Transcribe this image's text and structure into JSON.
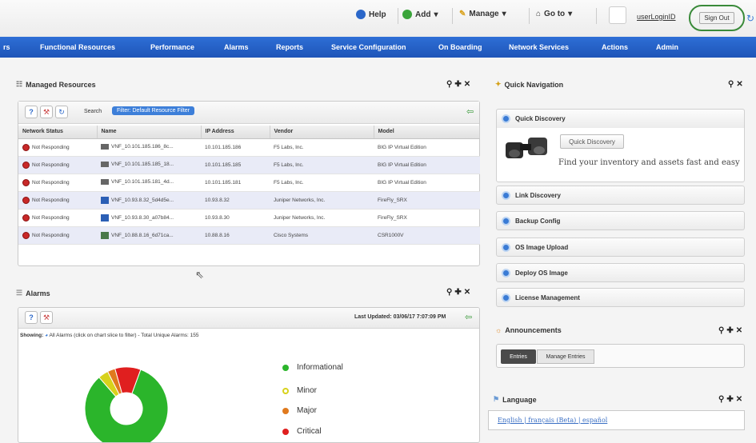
{
  "topbar": {
    "help": "Help",
    "add": "Add",
    "manage": "Manage",
    "goto": "Go to",
    "user": "userLoginID",
    "signout": "Sign Out"
  },
  "mainnav": [
    "rs",
    "Functional Resources",
    "Performance",
    "Alarms",
    "Reports",
    "Service Configuration",
    "On Boarding",
    "Network Services",
    "Actions",
    "Admin"
  ],
  "managed": {
    "title": "Managed Resources",
    "search_label": "Search",
    "filter": "Filter: Default Resource Filter",
    "columns": [
      "Network Status",
      "Name",
      "IP Address",
      "Vendor",
      "Model"
    ],
    "rows": [
      {
        "status": "Not Responding",
        "name": "VNF_10.101.185.186_8c...",
        "ip": "10.101.185.186",
        "vendor": "F5 Labs, Inc.",
        "model": "BIG IP Virtual Edition"
      },
      {
        "status": "Not Responding",
        "name": "VNF_10.101.185.185_18...",
        "ip": "10.101.185.185",
        "vendor": "F5 Labs, Inc.",
        "model": "BIG IP Virtual Edition"
      },
      {
        "status": "Not Responding",
        "name": "VNF_10.101.185.181_4d...",
        "ip": "10.101.185.181",
        "vendor": "F5 Labs, Inc.",
        "model": "BIG IP Virtual Edition"
      },
      {
        "status": "Not Responding",
        "name": "VNF_10.93.8.32_5d4d5e...",
        "ip": "10.93.8.32",
        "vendor": "Juniper Networks, Inc.",
        "model": "FireFly_SRX"
      },
      {
        "status": "Not Responding",
        "name": "VNF_10.93.8.30_a07b84...",
        "ip": "10.93.8.30",
        "vendor": "Juniper Networks, Inc.",
        "model": "FireFly_SRX"
      },
      {
        "status": "Not Responding",
        "name": "VNF_10.88.8.16_6d71ca...",
        "ip": "10.88.8.16",
        "vendor": "Cisco Systems",
        "model": "CSR1000V"
      }
    ]
  },
  "alarms": {
    "title": "Alarms",
    "last_updated": "Last Updated: 03/06/17 7:07:09 PM",
    "showing": "Showing:",
    "showing_text": "All Alarms (click on chart slice to filter) - Total Unique Alarms: 155",
    "legend": [
      {
        "label": "Informational",
        "color": "#2bb52b"
      },
      {
        "label": "Minor",
        "color": "#d8d21c"
      },
      {
        "label": "Major",
        "color": "#e07a1e"
      },
      {
        "label": "Critical",
        "color": "#e01f1f"
      }
    ]
  },
  "chart_data": {
    "type": "pie",
    "categories": [
      "Informational",
      "Minor",
      "Major",
      "Critical"
    ],
    "values": [
      83,
      4,
      3,
      10
    ]
  },
  "quicknav": {
    "title": "Quick Navigation",
    "quick_discovery": "Quick Discovery",
    "qd_button": "Quick Discovery",
    "qd_text": "Find your inventory and assets fast and easy",
    "items": [
      "Link Discovery",
      "Backup Config",
      "OS Image Upload",
      "Deploy OS Image",
      "License Management"
    ]
  },
  "announcements": {
    "title": "Announcements",
    "tab1": "Entries",
    "tab2": "Manage Entries"
  },
  "language": {
    "title": "Language",
    "links": "English | français (Beta) | español"
  }
}
